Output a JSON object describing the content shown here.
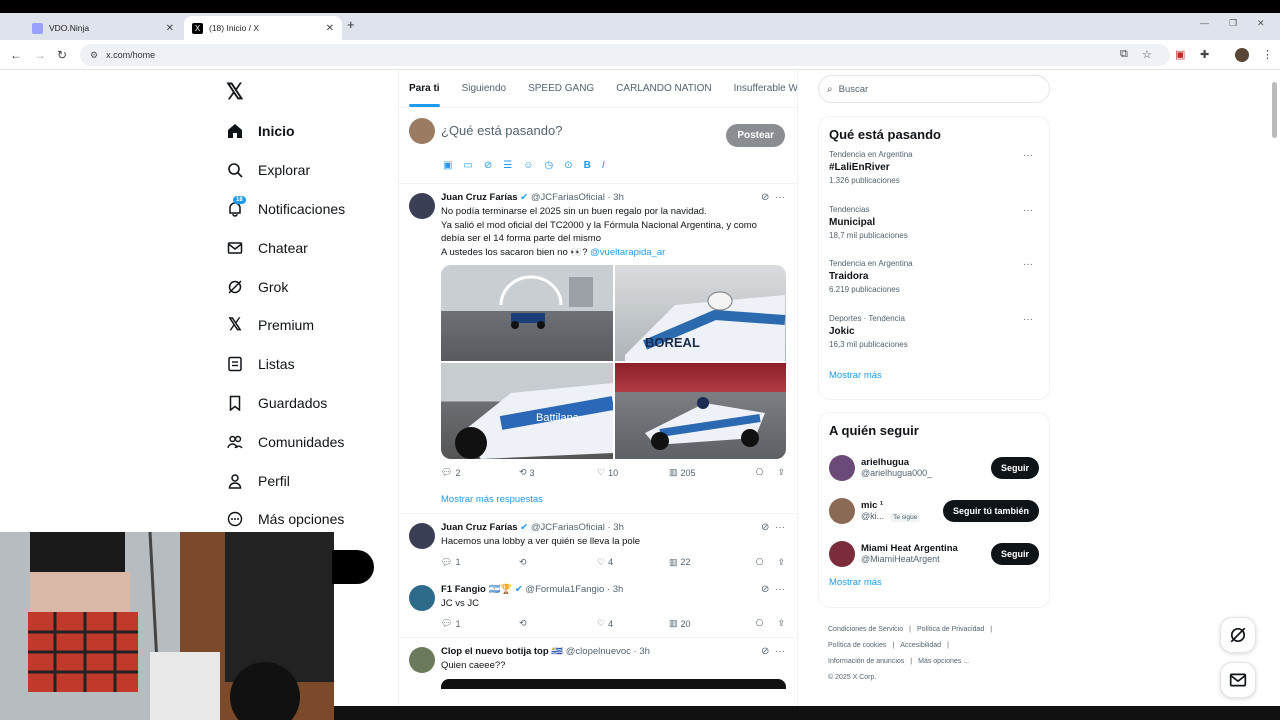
{
  "browser": {
    "tabs": [
      {
        "label": "VDO.Ninja",
        "fav_color": "#9aa0ff"
      },
      {
        "label": "(18) Inicio / X",
        "fav_color": "#000000"
      }
    ],
    "new_tab": "+",
    "url": "x.com/home"
  },
  "nav": {
    "logo": "𝕏",
    "items": [
      {
        "label": "Inicio",
        "icon": "home-icon"
      },
      {
        "label": "Explorar",
        "icon": "search-icon"
      },
      {
        "label": "Notificaciones",
        "icon": "bell-icon",
        "badge": "18"
      },
      {
        "label": "Chatear",
        "icon": "mail-icon"
      },
      {
        "label": "Grok",
        "icon": "grok-icon"
      },
      {
        "label": "Premium",
        "icon": "x-icon"
      },
      {
        "label": "Listas",
        "icon": "list-icon"
      },
      {
        "label": "Guardados",
        "icon": "bookmark-icon"
      },
      {
        "label": "Comunidades",
        "icon": "people-icon"
      },
      {
        "label": "Perfil",
        "icon": "person-icon"
      },
      {
        "label": "Más opciones",
        "icon": "more-icon"
      }
    ]
  },
  "feed": {
    "tabs": [
      "Para ti",
      "Siguiendo",
      "SPEED GANG",
      "CARLANDO NATION",
      "Insufferable W"
    ],
    "compose_placeholder": "¿Qué está pasando?",
    "post_label": "Postear",
    "tweets": [
      {
        "name": "Juan Cruz Farías",
        "handle": "@JCFariasOficial",
        "time": "· 3h",
        "lines": [
          "No podía terminarse el 2025 sin un buen regalo por la navidad.",
          "Ya salió el mod oficial del TC2000 y la Fórmula Nacional Argentina, y como",
          "debía ser el 14 forma parte del mismo",
          "A ustedes los sacaron bien no 👀?"
        ],
        "mention": "@vueltarapida_ar",
        "replies": "2",
        "reposts": "3",
        "likes": "10",
        "views": "205"
      },
      {
        "name": "Juan Cruz Farías",
        "handle": "@JCFariasOficial",
        "time": "· 3h",
        "lines": [
          "Hacemos una lobby a ver quién se lleva la pole"
        ],
        "replies": "1",
        "reposts": "",
        "likes": "4",
        "views": "22"
      },
      {
        "name": "F1 Fangio 🇦🇷🏆",
        "handle": "@Formula1Fangio",
        "time": "· 3h",
        "lines": [
          "JC vs JC"
        ],
        "replies": "1",
        "reposts": "",
        "likes": "4",
        "views": "20"
      },
      {
        "name": "Clop el nuevo botija top 🇺🇾",
        "handle": "@clopelnuevoc",
        "time": "· 3h",
        "lines": [
          "Quien caeee??"
        ]
      }
    ],
    "more_replies": "Mostrar más respuestas"
  },
  "right": {
    "search_placeholder": "Buscar",
    "trends_title": "Qué está pasando",
    "trends": [
      {
        "context": "Tendencia en Argentina",
        "topic": "#LaliEnRiver",
        "count": "1.326 publicaciones"
      },
      {
        "context": "Tendencias",
        "topic": "Municipal",
        "count": "18,7 mil publicaciones"
      },
      {
        "context": "Tendencia en Argentina",
        "topic": "Traidora",
        "count": "6.219 publicaciones"
      },
      {
        "context": "Deportes · Tendencia",
        "topic": "Jokic",
        "count": "16,3 mil publicaciones"
      }
    ],
    "show_more": "Mostrar más",
    "who_title": "A quién seguir",
    "who": [
      {
        "name": "arielhugua",
        "handle": "@arielhugua000_",
        "button": "Seguir",
        "color": "#6b4a7a"
      },
      {
        "name": "mic ¹",
        "handle": "@ki...",
        "button": "Seguir tú también",
        "follows_you": "Te sigue",
        "color": "#8a6a55"
      },
      {
        "name": "Miami Heat Argentina",
        "handle": "@MiamiHeatArgent",
        "button": "Seguir",
        "color": "#7a2c3a"
      }
    ],
    "footer": [
      "Condiciones de Servicio",
      "|",
      "Política de Privacidad",
      "|",
      "Política de cookies",
      "|",
      "Accesibilidad",
      "|",
      "Información de anuncios",
      "|",
      "Más opciones ...",
      "© 2025 X Corp."
    ]
  }
}
